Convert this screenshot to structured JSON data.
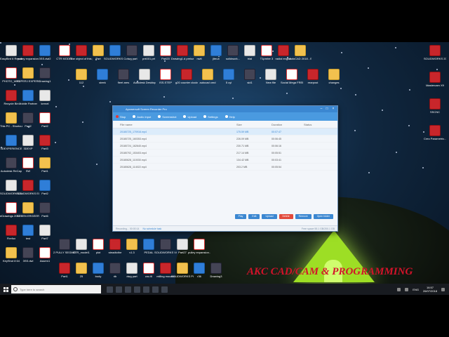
{
  "desktop": {
    "icons_col1": [
      "EasyBird 6 Resources",
      "PHOTO_WHT",
      "Recycle Bin",
      "This PC - Shortcut",
      "3DEXPERIENCE",
      "Autodesk ReCap",
      "SOLIDWORKS Explorer 2017",
      "eDrawings 2017 x64",
      "Firefox",
      "KeyShot 8 64"
    ],
    "icons_col2": [
      "pulley expansion",
      "SUPERJ EXPERIENCE",
      "Mobile Partner",
      "Part2",
      "3DEXP",
      "SW",
      "SOLIDWORKS Electrical",
      "SOTEN ERGEER",
      "test",
      "3SS.dwl"
    ],
    "icons_col3": [
      "3SS.dwl2",
      "Drawing1",
      "kernel",
      "Part2",
      "Part3",
      "Part1",
      "Part2",
      "Part6",
      "Part7",
      "Assem1"
    ],
    "icons_top": [
      "CTR MODEL",
      "The object of this project...",
      "Part",
      "SOLIDWORKS Composer...",
      "dwg part",
      "pnt001.prt",
      "Part20",
      "Drawing1.d preload 1",
      "nwlt",
      "jiteu4",
      "solidwork...",
      "trial",
      "T1prnter 3",
      "radial engine",
      "AutoCAD 2018 - E..."
    ],
    "icons_row2": [
      "112",
      "steek",
      "fleet ares",
      "Autodesk Desktop App",
      "ISS.STEP",
      "g20 counter clockwise",
      "autocad cmd",
      "5 cyl",
      "sid1",
      "New file",
      "Social Mega FREE",
      "rearpost",
      "changes"
    ],
    "icons_right": [
      "SOLIDWORKS 2017",
      "Mastercam X9",
      "SSCNC",
      "Creo Parametric..."
    ],
    "icons_bottom": [
      "2 PULLY SEGMENT",
      "CTR_model1",
      "plot",
      "steadtothe",
      "v1.3",
      "PEDAL",
      "SOLIDWORKS Visualize Bo...",
      "Part27",
      "pulley expansion...",
      "Part1",
      "25",
      "body",
      "rib",
      "dwg part",
      "cnc.tll",
      "milling mocam",
      "SOLIDWORKS PCB 2017",
      "r36",
      "Drawing3"
    ]
  },
  "window": {
    "title": "Apowersoft Screen Recorder Pro",
    "toolbar": {
      "stop": "Stop",
      "audio": "Audio input",
      "screenshot": "Screenshot",
      "upload": "Upload",
      "settings": "Settings",
      "help": "Help"
    },
    "columns": {
      "name": "File name",
      "size": "Size",
      "duration": "Duration",
      "status": "Status"
    },
    "rows": [
      {
        "name": "20180725_170916.mp4",
        "size": "175.59 MB",
        "duration": "00:07:47",
        "status": ""
      },
      {
        "name": "20180725_160353.mp4",
        "size": "226.09 MB",
        "duration": "00:06:45",
        "status": ""
      },
      {
        "name": "20180724_162640.mp4",
        "size": "230.71 MB",
        "duration": "00:06:16",
        "status": ""
      },
      {
        "name": "20180702_153403.mp4",
        "size": "217.14 MB",
        "duration": "00:05:51",
        "status": ""
      },
      {
        "name": "20180628_110030.mp4",
        "size": "134.42 MB",
        "duration": "00:03:41",
        "status": ""
      },
      {
        "name": "20180628_114022.mp4",
        "size": "203.2 MB",
        "duration": "00:05:54",
        "status": ""
      }
    ],
    "buttons": {
      "play": "Play",
      "edit": "Edit",
      "upload": "Upload",
      "delete": "Delete",
      "remove": "Remove",
      "open_folder": "Open folder"
    },
    "status": {
      "recording": "Recording... 00:00:14",
      "link": "No schedule task",
      "right": "Free space 55.1 GB/200.1 GB"
    }
  },
  "watermark": "AKC CAD/CAM & PROGRAMMING",
  "taskbar": {
    "search_placeholder": "Type here to search",
    "lang": "ENG",
    "time": "16:57",
    "date": "26/07/2018"
  },
  "colors": {
    "accent": "#3b87d1",
    "watermark": "#d4122a",
    "tent": "#9dde25"
  }
}
